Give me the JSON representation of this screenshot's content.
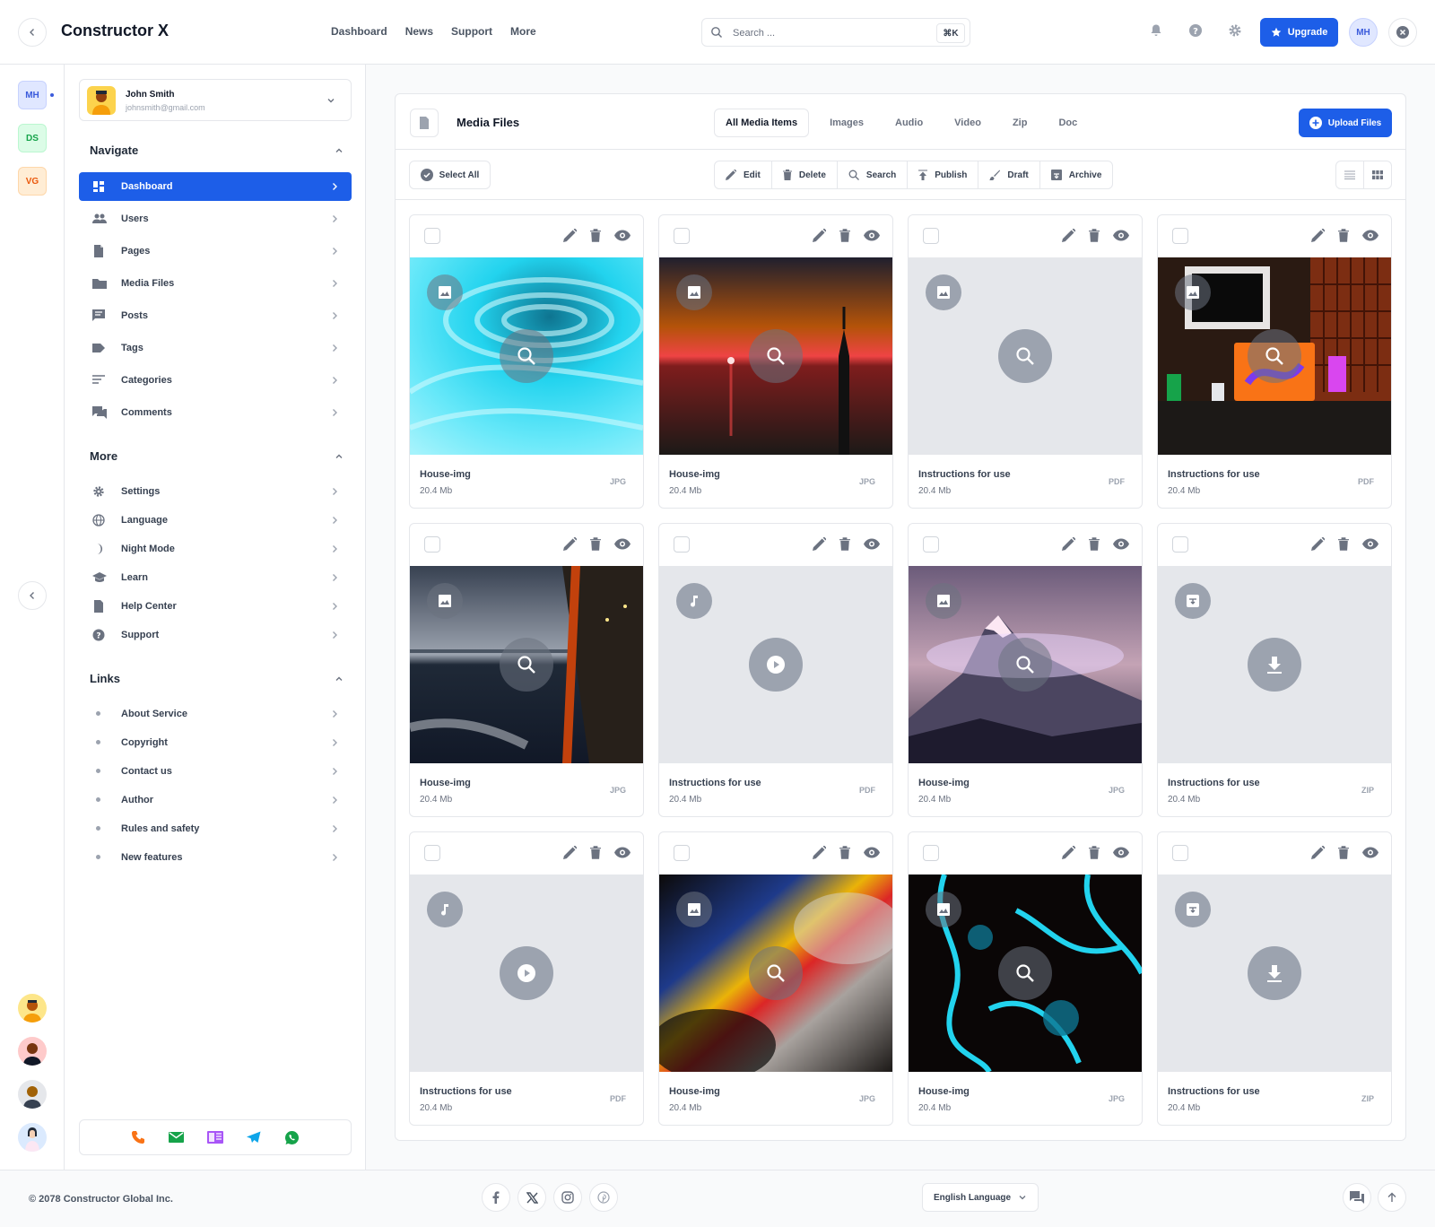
{
  "app": {
    "title": "Constructor X"
  },
  "topnav": [
    "Dashboard",
    "News",
    "Support",
    "More"
  ],
  "search": {
    "placeholder": "Search ...",
    "shortcut": "⌘K"
  },
  "upgrade": {
    "label": "Upgrade"
  },
  "account": {
    "initials": "MH"
  },
  "workspaces": [
    {
      "initials": "MH",
      "color": "#3b5bdb"
    },
    {
      "initials": "DS",
      "color": "#16a34a"
    },
    {
      "initials": "VG",
      "color": "#ea580c"
    }
  ],
  "user": {
    "name": "John Smith",
    "email": "johnsmith@gmail.com"
  },
  "sections": {
    "navigate": {
      "title": "Navigate",
      "items": [
        {
          "label": "Dashboard",
          "icon": "dashboard-icon"
        },
        {
          "label": "Users",
          "icon": "users-icon"
        },
        {
          "label": "Pages",
          "icon": "page-icon"
        },
        {
          "label": "Media Files",
          "icon": "folder-icon"
        },
        {
          "label": "Posts",
          "icon": "post-icon"
        },
        {
          "label": "Tags",
          "icon": "tag-icon"
        },
        {
          "label": "Categories",
          "icon": "categories-icon"
        },
        {
          "label": "Comments",
          "icon": "comments-icon"
        }
      ]
    },
    "more": {
      "title": "More",
      "items": [
        {
          "label": "Settings",
          "icon": "gear-icon"
        },
        {
          "label": "Language",
          "icon": "globe-icon"
        },
        {
          "label": "Night Mode",
          "icon": "moon-icon"
        },
        {
          "label": "Learn",
          "icon": "graduation-icon"
        },
        {
          "label": "Help Center",
          "icon": "help-doc-icon"
        },
        {
          "label": "Support",
          "icon": "question-icon"
        }
      ]
    },
    "links": {
      "title": "Links",
      "items": [
        "About Service",
        "Copyright",
        "Contact us",
        "Author",
        "Rules and safety",
        "New features"
      ]
    }
  },
  "panel": {
    "title": "Media Files",
    "tabs": [
      "All Media Items",
      "Images",
      "Audio",
      "Video",
      "Zip",
      "Doc"
    ],
    "upload_label": "Upload Files",
    "select_all": "Select All",
    "actions": [
      "Edit",
      "Delete",
      "Search",
      "Publish",
      "Draft",
      "Archive"
    ]
  },
  "media": [
    {
      "name": "House-img",
      "size": "20.4 Mb",
      "type": "JPG",
      "kind": "image",
      "thumb": "teal-swirl"
    },
    {
      "name": "House-img",
      "size": "20.4 Mb",
      "type": "JPG",
      "kind": "image",
      "thumb": "sunset-tower"
    },
    {
      "name": "Instructions for use",
      "size": "20.4 Mb",
      "type": "PDF",
      "kind": "image",
      "thumb": "placeholder"
    },
    {
      "name": "Instructions for use",
      "size": "20.4 Mb",
      "type": "PDF",
      "kind": "image",
      "thumb": "desk-setup"
    },
    {
      "name": "House-img",
      "size": "20.4 Mb",
      "type": "JPG",
      "kind": "image",
      "thumb": "ferry-sea"
    },
    {
      "name": "Instructions for use",
      "size": "20.4 Mb",
      "type": "PDF",
      "kind": "audio",
      "thumb": "placeholder"
    },
    {
      "name": "House-img",
      "size": "20.4 Mb",
      "type": "JPG",
      "kind": "image",
      "thumb": "mountain"
    },
    {
      "name": "Instructions for use",
      "size": "20.4 Mb",
      "type": "ZIP",
      "kind": "archive",
      "thumb": "placeholder"
    },
    {
      "name": "Instructions for use",
      "size": "20.4 Mb",
      "type": "PDF",
      "kind": "audio",
      "thumb": "placeholder"
    },
    {
      "name": "House-img",
      "size": "20.4 Mb",
      "type": "JPG",
      "kind": "image",
      "thumb": "prism-light"
    },
    {
      "name": "House-img",
      "size": "20.4 Mb",
      "type": "JPG",
      "kind": "image",
      "thumb": "blue-fluid"
    },
    {
      "name": "Instructions for use",
      "size": "20.4 Mb",
      "type": "ZIP",
      "kind": "archive",
      "thumb": "placeholder"
    }
  ],
  "footer": {
    "copyright": "© 2078 Constructor Global Inc.",
    "language": "English Language",
    "socials": [
      "facebook-icon",
      "x-icon",
      "instagram-icon",
      "pinterest-icon"
    ]
  },
  "colors": {
    "accent": "#1d5ee8"
  }
}
